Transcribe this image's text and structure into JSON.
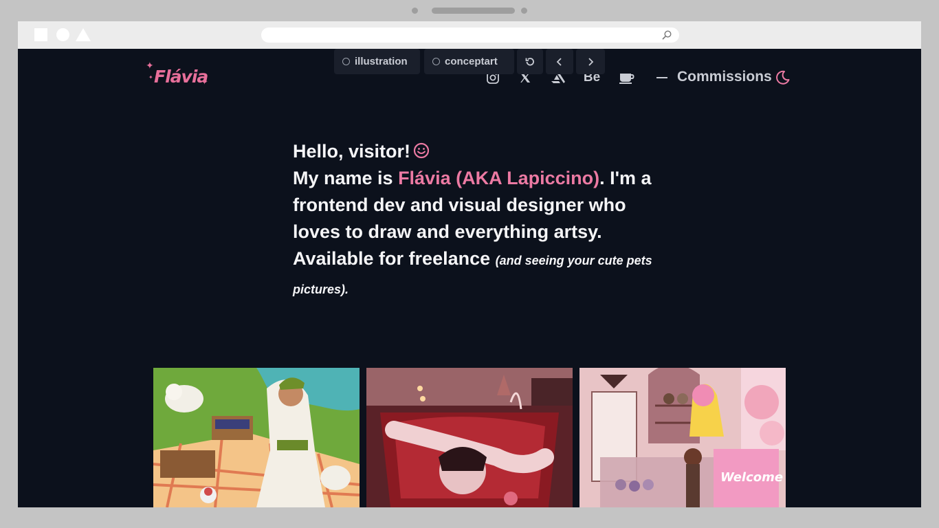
{
  "browser": {
    "address_value": ""
  },
  "header": {
    "logo_text": "Flávia",
    "nav": {
      "instagram_icon": "instagram-icon",
      "x_icon": "x-twitter-icon",
      "artstation_icon": "artstation-icon",
      "behance_label": "Bē",
      "kofi_icon": "coffee-cup-icon",
      "commissions_label": "Commissions",
      "theme_icon": "moon-icon"
    }
  },
  "intro": {
    "greeting": "Hello, visitor!",
    "line_prefix": "My name is ",
    "name_highlight": "Flávia (AKA Lapiccino)",
    "line_rest": ". I'm a frontend dev and visual designer who loves to draw and everything artsy. Available for freelance ",
    "aside": "(and seeing your cute pets pictures)."
  },
  "filters": {
    "tags": [
      "illustration",
      "conceptart"
    ],
    "reset_icon": "reset-icon",
    "prev_icon": "chevron-left-icon",
    "next_icon": "chevron-right-icon"
  },
  "colors": {
    "background": "#0c111c",
    "accent": "#ec7aa3",
    "text": "#f5f5f7",
    "muted": "#c9ccd4",
    "chip": "#1a1f2b"
  }
}
